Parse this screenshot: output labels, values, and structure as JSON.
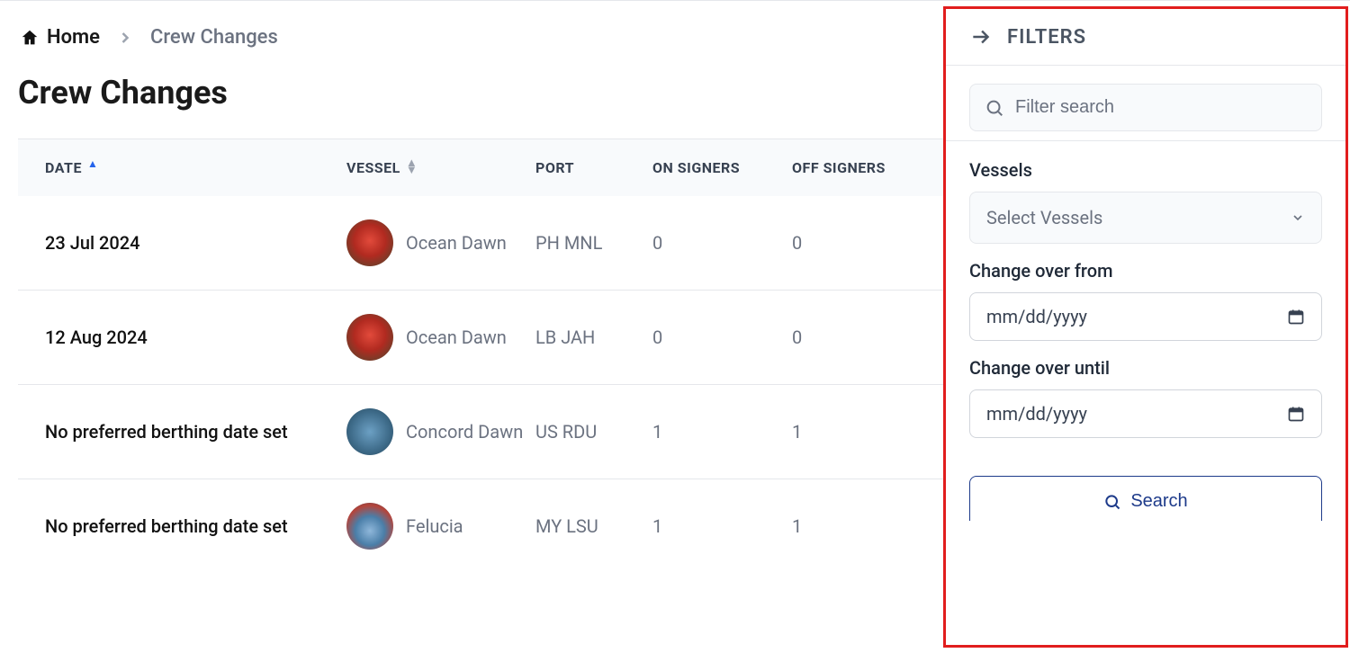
{
  "breadcrumb": {
    "home": "Home",
    "current": "Crew Changes"
  },
  "page_title": "Crew Changes",
  "table": {
    "columns": {
      "date": "DATE",
      "vessel": "VESSEL",
      "port": "PORT",
      "on_signers": "ON SIGNERS",
      "off_signers": "OFF SIGNERS"
    },
    "rows": [
      {
        "date": "23 Jul 2024",
        "vessel": "Ocean Dawn",
        "port": "PH MNL",
        "on": "0",
        "off": "0",
        "avatar": "ship1"
      },
      {
        "date": "12 Aug 2024",
        "vessel": "Ocean Dawn",
        "port": "LB JAH",
        "on": "0",
        "off": "0",
        "avatar": "ship1"
      },
      {
        "date": "No preferred berthing date set",
        "vessel": "Concord Dawn",
        "port": "US RDU",
        "on": "1",
        "off": "1",
        "avatar": "ship2"
      },
      {
        "date": "No preferred berthing date set",
        "vessel": "Felucia",
        "port": "MY LSU",
        "on": "1",
        "off": "1",
        "avatar": "ship3"
      }
    ]
  },
  "filters": {
    "title": "FILTERS",
    "search_placeholder": "Filter search",
    "vessels_label": "Vessels",
    "vessels_placeholder": "Select Vessels",
    "from_label": "Change over from",
    "until_label": "Change over until",
    "date_placeholder": "mm/dd/yyyy",
    "search_button": "Search"
  }
}
